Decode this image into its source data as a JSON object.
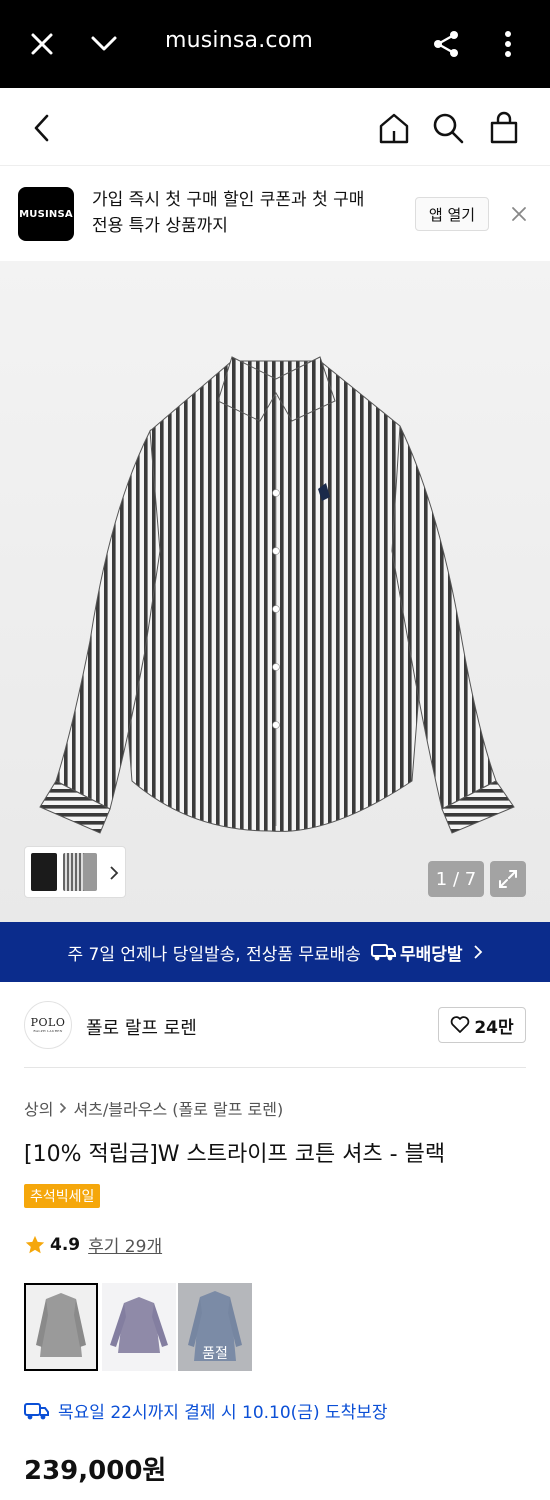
{
  "browser": {
    "url": "musinsa.com"
  },
  "app_banner": {
    "logo_text": "MUSINSA",
    "line1": "가입 즉시 첫 구매 할인 쿠폰과 첫 구매",
    "line2": "전용 특가 상품까지",
    "open_label": "앱 열기"
  },
  "gallery": {
    "counter": "1 / 7"
  },
  "shipping_banner": {
    "text": "주 7일 언제나 당일발송, 전상품 무료배송",
    "badge": "무배당발"
  },
  "brand": {
    "logo_text": "POLO",
    "logo_sub": "RALPH LAUREN",
    "name": "폴로 랄프 로렌",
    "likes": "24만"
  },
  "breadcrumb": {
    "category": "상의",
    "sub": "셔츠/블라우스 (폴로 랄프 로렌)"
  },
  "product": {
    "title": "[10% 적립금]W 스트라이프 코튼 셔츠 - 블랙",
    "sale_badge": "추석빅세일",
    "rating": "4.9",
    "reviews": "후기 29개",
    "sold_out_label": "품절",
    "delivery": "목요일 22시까지 결제 시 10.10(금) 도착보장",
    "price": "239,000원"
  },
  "colors": {
    "accent_blue": "#0b2c8c",
    "sale_orange": "#f5a70b",
    "star": "#f5a70b"
  }
}
